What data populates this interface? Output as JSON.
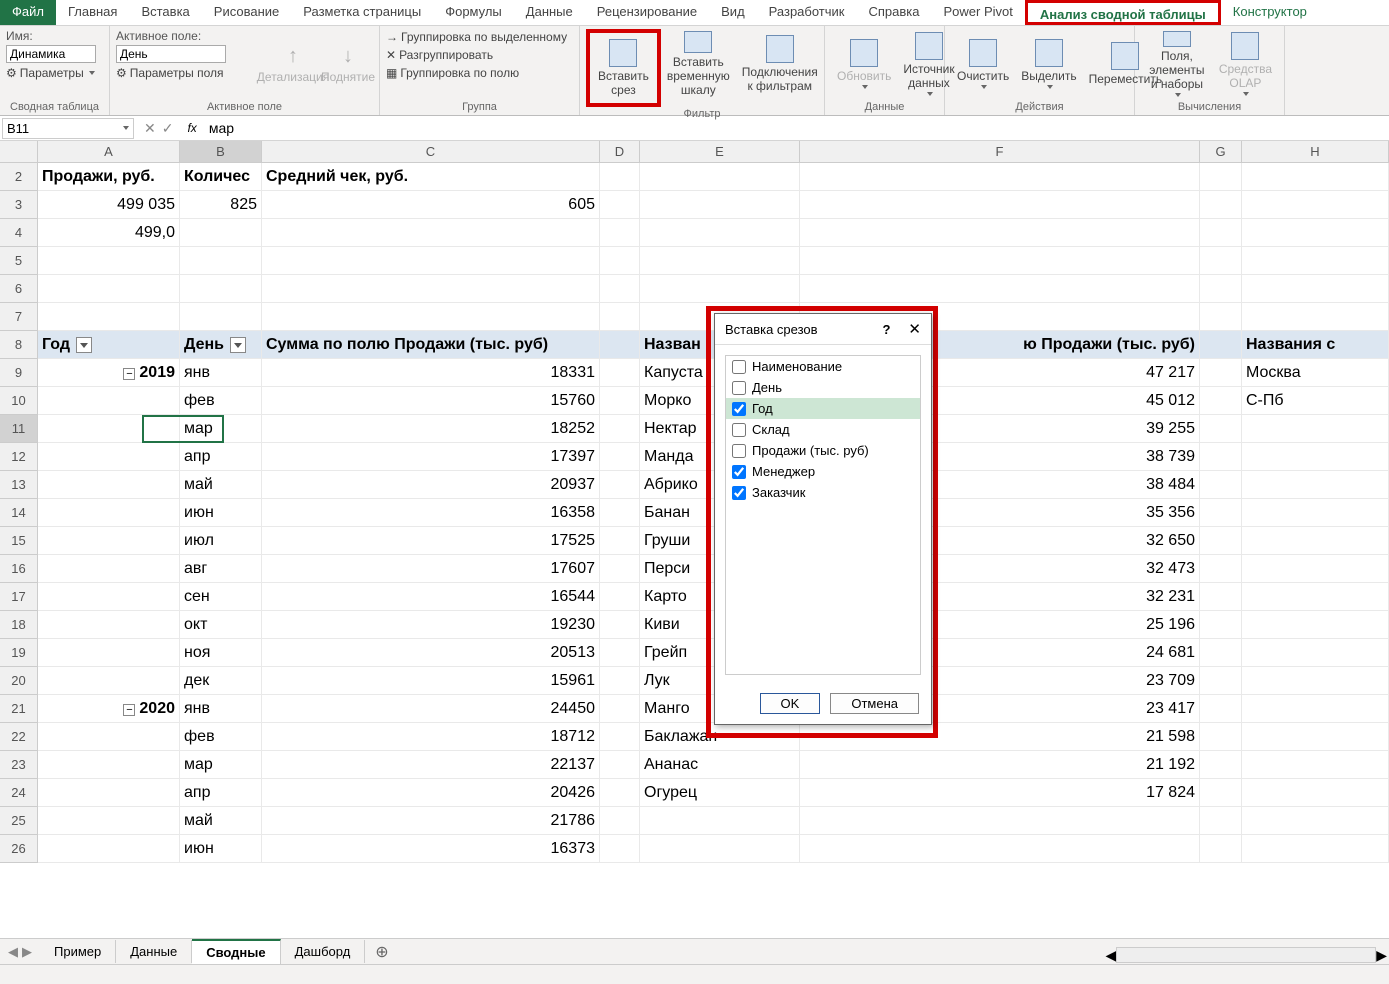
{
  "tabs": {
    "file": "Файл",
    "home": "Главная",
    "insert": "Вставка",
    "draw": "Рисование",
    "layout": "Разметка страницы",
    "formulas": "Формулы",
    "data": "Данные",
    "review": "Рецензирование",
    "view": "Вид",
    "developer": "Разработчик",
    "help": "Справка",
    "powerpivot": "Power Pivot",
    "analyze": "Анализ сводной таблицы",
    "design": "Конструктор"
  },
  "ribbon": {
    "pivotname_label": "Имя:",
    "pivotname": "Динамика",
    "params": "Параметры",
    "group1": "Сводная таблица",
    "activefield_label": "Активное поле:",
    "activefield": "День",
    "fieldparams": "Параметры поля",
    "detail": "Детализация",
    "collapse": "Поднятие",
    "group2": "Активное поле",
    "grp_sel": "Группировка по выделенному",
    "ungrp": "Разгруппировать",
    "grp_fld": "Группировка по полю",
    "group3": "Группа",
    "slicer": "Вставить срез",
    "timeline": "Вставить временную шкалу",
    "filterconn": "Подключения к фильтрам",
    "group4": "Фильтр",
    "refresh": "Обновить",
    "datasrc": "Источник данных",
    "group5": "Данные",
    "clear": "Очистить",
    "select": "Выделить",
    "move": "Переместить",
    "group6": "Действия",
    "fields": "Поля, элементы и наборы",
    "olap": "Средства OLAP",
    "group7": "Вычисления"
  },
  "namebox": "B11",
  "formula": "мар",
  "cols": [
    "A",
    "B",
    "C",
    "D",
    "E",
    "F",
    "G",
    "H"
  ],
  "rows": [
    "2",
    "3",
    "4",
    "5",
    "6",
    "7",
    "8",
    "9",
    "10",
    "11",
    "12",
    "13",
    "14",
    "15",
    "16",
    "17",
    "18",
    "19",
    "20",
    "21",
    "22",
    "23",
    "24",
    "25",
    "26"
  ],
  "pivot": {
    "h_a2": "Продажи, руб.",
    "h_b2": "Количес",
    "h_c2": "Средний чек, руб.",
    "a3": "499 035",
    "b3": "825",
    "c3": "605",
    "a4": "499,0",
    "h_a8": "Год",
    "h_b8": "День",
    "h_c8": "Сумма по полю Продажи (тыс. руб)",
    "h_e8": "Назван",
    "h_f8": "ю Продажи (тыс. руб)",
    "h_h8": "Названия с",
    "years": [
      "2019",
      "2020"
    ],
    "months19": [
      "янв",
      "фев",
      "мар",
      "апр",
      "май",
      "июн",
      "июл",
      "авг",
      "сен",
      "окт",
      "ноя",
      "дек"
    ],
    "vals19": [
      "18331",
      "15760",
      "18252",
      "17397",
      "20937",
      "16358",
      "17525",
      "17607",
      "16544",
      "19230",
      "20513",
      "15961"
    ],
    "months20": [
      "янв",
      "фев",
      "мар",
      "апр",
      "май",
      "июн"
    ],
    "vals20": [
      "24450",
      "18712",
      "22137",
      "20426",
      "21786",
      "16373"
    ],
    "items": [
      "Капуста",
      "Морко",
      "Нектар",
      "Манда",
      "Абрико",
      "Банан",
      "Груши",
      "Перси",
      "Карто",
      "Киви",
      "Грейп",
      "Лук",
      "Манго",
      "Баклажан",
      "Ананас",
      "Огурец"
    ],
    "fvals": [
      "47 217",
      "45 012",
      "39 255",
      "38 739",
      "38 484",
      "35 356",
      "32 650",
      "32 473",
      "32 231",
      "25 196",
      "24 681",
      "23 709",
      "23 417",
      "21 598",
      "21 192",
      "17 824"
    ],
    "cities": [
      "Москва",
      "С-Пб"
    ]
  },
  "dialog": {
    "title": "Вставка срезов",
    "ok": "OK",
    "cancel": "Отмена",
    "items": [
      {
        "label": "Наименование",
        "checked": false
      },
      {
        "label": "День",
        "checked": false
      },
      {
        "label": "Год",
        "checked": true,
        "selected": true
      },
      {
        "label": "Склад",
        "checked": false
      },
      {
        "label": "Продажи (тыс. руб)",
        "checked": false
      },
      {
        "label": "Менеджер",
        "checked": true
      },
      {
        "label": "Заказчик",
        "checked": true
      }
    ]
  },
  "sheets": {
    "s1": "Пример",
    "s2": "Данные",
    "s3": "Сводные",
    "s4": "Дашборд"
  }
}
